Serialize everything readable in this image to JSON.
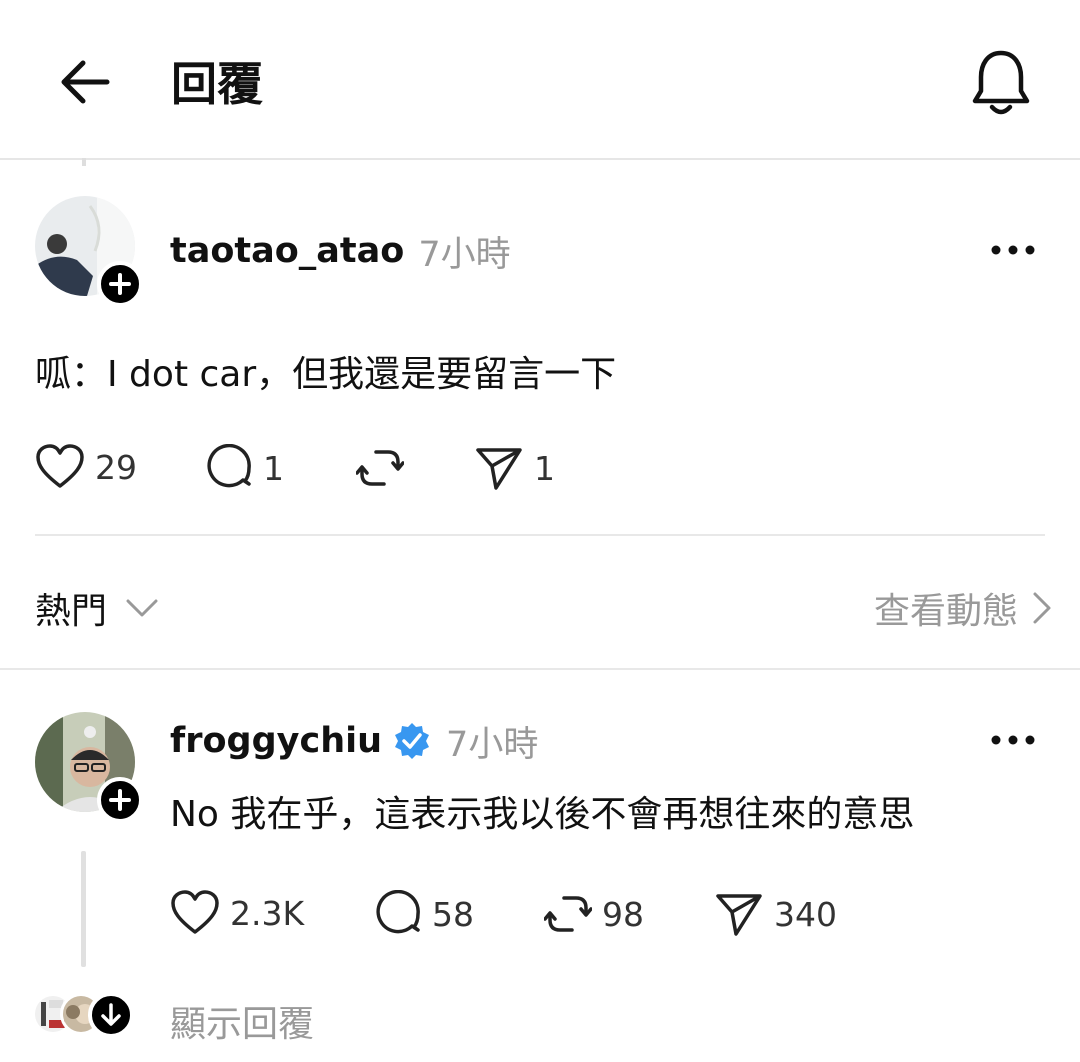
{
  "header": {
    "title": "回覆"
  },
  "post1": {
    "username": "taotao_atao",
    "time": "7小時",
    "text": "呱：I dot car，但我還是要留言一下",
    "likes": "29",
    "replies": "1",
    "shares": "1"
  },
  "sort_bar": {
    "sort_label": "熱門",
    "activity_label": "查看動態"
  },
  "post2": {
    "username": "froggychiu",
    "verified": true,
    "time": "7小時",
    "text": "No 我在乎，這表示我以後不會再想往來的意思",
    "likes": "2.3K",
    "replies": "58",
    "reposts": "98",
    "shares": "340",
    "show_replies_label": "顯示回覆"
  },
  "colors": {
    "verified_badge": "#3897f0",
    "muted_text": "#999999",
    "divider": "#e8e8e8"
  },
  "icons": [
    "back-arrow-icon",
    "bell-icon",
    "more-icon",
    "heart-icon",
    "comment-icon",
    "repost-icon",
    "send-icon",
    "chevron-down-icon",
    "chevron-right-icon",
    "plus-icon",
    "verified-icon",
    "arrow-down-icon"
  ]
}
